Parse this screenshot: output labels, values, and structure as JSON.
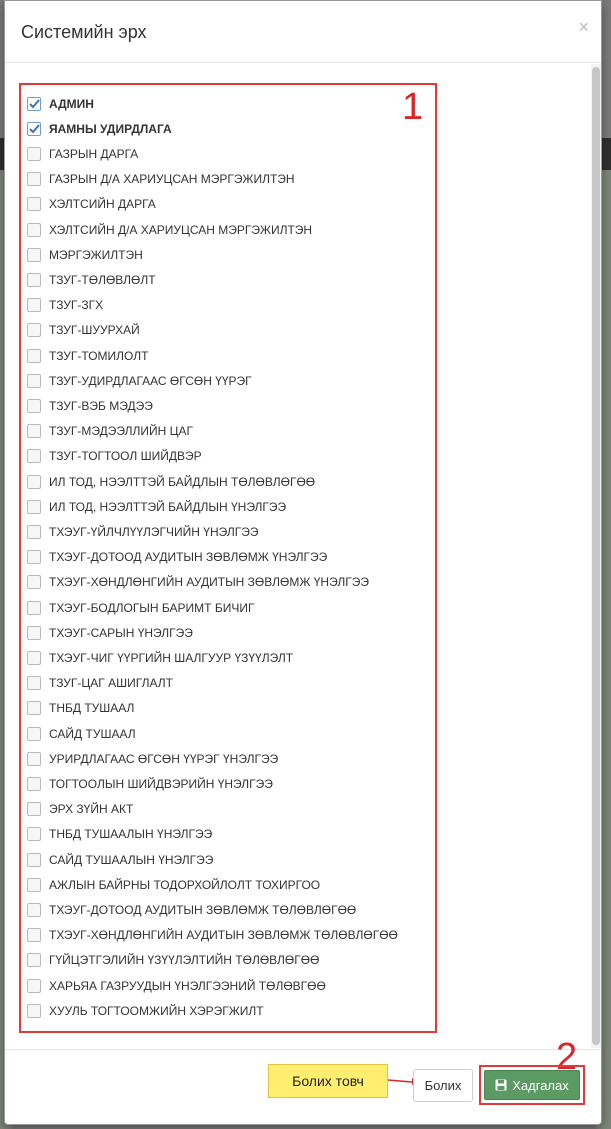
{
  "modal": {
    "title": "Системийн эрх",
    "close_symbol": "×"
  },
  "roles": [
    {
      "label": "АДМИН",
      "checked": true,
      "bold": true
    },
    {
      "label": "ЯАМНЫ УДИРДЛАГА",
      "checked": true,
      "bold": true
    },
    {
      "label": "ГАЗРЫН ДАРГА",
      "checked": false
    },
    {
      "label": "ГАЗРЫН Д/А ХАРИУЦСАН МЭРГЭЖИЛТЭН",
      "checked": false
    },
    {
      "label": "ХЭЛТСИЙН ДАРГА",
      "checked": false
    },
    {
      "label": "ХЭЛТСИЙН Д/А ХАРИУЦСАН МЭРГЭЖИЛТЭН",
      "checked": false
    },
    {
      "label": "МЭРГЭЖИЛТЭН",
      "checked": false
    },
    {
      "label": "ТЗУГ-ТӨЛӨВЛӨЛТ",
      "checked": false
    },
    {
      "label": "ТЗУГ-ЗГХ",
      "checked": false
    },
    {
      "label": "ТЗУГ-ШУУРХАЙ",
      "checked": false
    },
    {
      "label": "ТЗУГ-ТОМИЛОЛТ",
      "checked": false
    },
    {
      "label": "ТЗУГ-УДИРДЛАГААС ӨГСӨН ҮҮРЭГ",
      "checked": false
    },
    {
      "label": "ТЗУГ-ВЭБ МЭДЭЭ",
      "checked": false
    },
    {
      "label": "ТЗУГ-МЭДЭЭЛЛИЙН ЦАГ",
      "checked": false
    },
    {
      "label": "ТЗУГ-ТОГТООЛ ШИЙДВЭР",
      "checked": false
    },
    {
      "label": "ИЛ ТОД, НЭЭЛТТЭЙ БАЙДЛЫН ТӨЛӨВЛӨГӨӨ",
      "checked": false
    },
    {
      "label": "ИЛ ТОД, НЭЭЛТТЭЙ БАЙДЛЫН ҮНЭЛГЭЭ",
      "checked": false
    },
    {
      "label": "ТХЭУГ-ҮЙЛЧЛҮҮЛЭГЧИЙН ҮНЭЛГЭЭ",
      "checked": false
    },
    {
      "label": "ТХЭУГ-ДОТООД АУДИТЫН ЗӨВЛӨМЖ ҮНЭЛГЭЭ",
      "checked": false
    },
    {
      "label": "ТХЭУГ-ХӨНДЛӨНГИЙН АУДИТЫН ЗӨВЛӨМЖ ҮНЭЛГЭЭ",
      "checked": false
    },
    {
      "label": "ТХЭУГ-БОДЛОГЫН БАРИМТ БИЧИГ",
      "checked": false
    },
    {
      "label": "ТХЭУГ-САРЫН ҮНЭЛГЭЭ",
      "checked": false
    },
    {
      "label": "ТХЭУГ-ЧИГ ҮҮРГИЙН ШАЛГУУР ҮЗҮҮЛЭЛТ",
      "checked": false
    },
    {
      "label": "ТЗУГ-ЦАГ АШИГЛАЛТ",
      "checked": false
    },
    {
      "label": "ТНБД ТУШААЛ",
      "checked": false
    },
    {
      "label": "САЙД ТУШААЛ",
      "checked": false
    },
    {
      "label": "УРИРДЛАГААС ӨГСӨН ҮҮРЭГ ҮНЭЛГЭЭ",
      "checked": false
    },
    {
      "label": "ТОГТООЛЫН ШИЙДВЭРИЙН ҮНЭЛГЭЭ",
      "checked": false
    },
    {
      "label": "ЭРХ ЗҮЙН АКТ",
      "checked": false
    },
    {
      "label": "ТНБД ТУШААЛЫН ҮНЭЛГЭЭ",
      "checked": false
    },
    {
      "label": "САЙД ТУШААЛЫН ҮНЭЛГЭЭ",
      "checked": false
    },
    {
      "label": "АЖЛЫН БАЙРНЫ ТОДОРХОЙЛОЛТ ТОХИРГОО",
      "checked": false
    },
    {
      "label": "ТХЭУГ-ДОТООД АУДИТЫН ЗӨВЛӨМЖ ТӨЛӨВЛӨГӨӨ",
      "checked": false
    },
    {
      "label": "ТХЭУГ-ХӨНДЛӨНГИЙН АУДИТЫН ЗӨВЛӨМЖ ТӨЛӨВЛӨГӨӨ",
      "checked": false
    },
    {
      "label": "ГҮЙЦЭТГЭЛИЙН ҮЗҮҮЛЭЛТИЙН ТӨЛӨВЛӨГӨӨ",
      "checked": false
    },
    {
      "label": "ХАРЬЯА ГАЗРУУДЫН ҮНЭЛГЭЭНИЙ ТӨЛӨВГӨӨ",
      "checked": false
    },
    {
      "label": "ХУУЛЬ ТОГТООМЖИЙН ХЭРЭГЖИЛТ",
      "checked": false
    }
  ],
  "annotations": {
    "marker_1": "1",
    "marker_2": "2",
    "callout_text": "Болих товч"
  },
  "footer": {
    "cancel_label": "Болих",
    "save_label": "Хадгалах"
  },
  "colors": {
    "annotation_red": "#e23a3a",
    "save_green": "#5c9a63",
    "callout_yellow": "#ffee70",
    "checkbox_blue": "#6c9ed3"
  }
}
